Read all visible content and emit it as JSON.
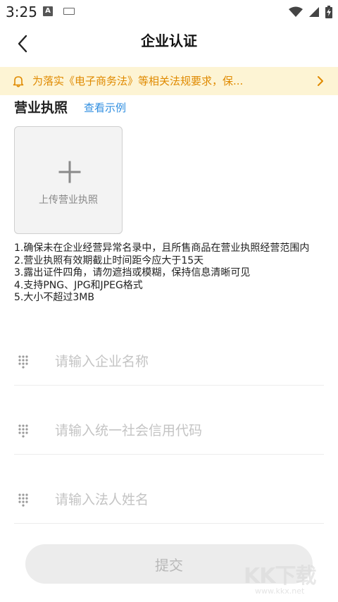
{
  "status_bar": {
    "time": "3:25",
    "a_badge": "A"
  },
  "header": {
    "title": "企业认证"
  },
  "notice": {
    "text": "为落实《电子商务法》等相关法规要求，保...",
    "accent_color": "#e08a00",
    "background_color": "#fdf4d4"
  },
  "license": {
    "title": "营业执照",
    "example_link": "查看示例",
    "upload_label": "上传营业执照"
  },
  "rules": [
    "1.确保未在企业经营异常名录中，且所售商品在营业执照经营范围内",
    "2.营业执照有效期截止时间距今应大于15天",
    "3.露出证件四角，请勿遮挡或模糊，保持信息清晰可见",
    "4.支持PNG、JPG和JPEG格式",
    "5.大小不超过3MB"
  ],
  "form": {
    "company_name": {
      "value": "",
      "placeholder": "请输入企业名称"
    },
    "credit_code": {
      "value": "",
      "placeholder": "请输入统一社会信用代码"
    },
    "legal_person": {
      "value": "",
      "placeholder": "请输入法人姓名"
    }
  },
  "submit_label": "提交",
  "watermark": {
    "logo_text": "KK下载",
    "url": "www.kkx.net"
  },
  "icons": {
    "back": "chevron-left-icon",
    "bell": "bell-icon",
    "notice_arrow": "chevron-right-icon",
    "upload": "plus-icon",
    "field": "keypad-icon"
  }
}
